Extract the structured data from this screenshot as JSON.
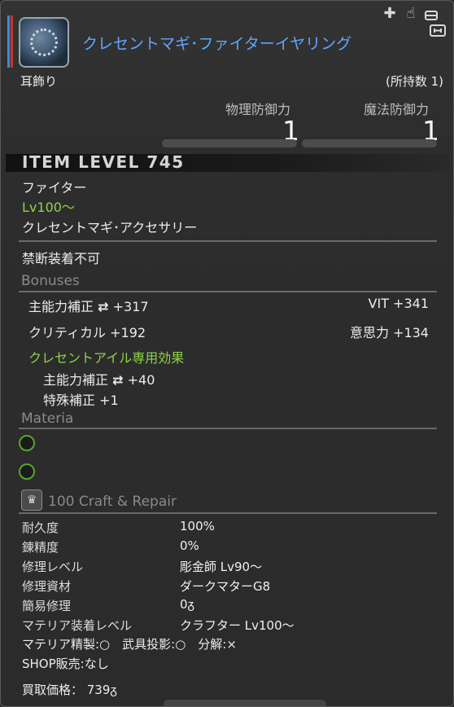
{
  "item": {
    "name": "クレセントマギ･ファイターイヤリング",
    "category": "耳飾り",
    "owned": "(所持数 1)"
  },
  "stats": [
    {
      "label": "物理防御力",
      "value": "1"
    },
    {
      "label": "魔法防御力",
      "value": "1"
    }
  ],
  "item_level": "ITEM LEVEL 745",
  "job": "ファイター",
  "level_req": "Lv100～",
  "item_type": "クレセントマギ･アクセサリー",
  "restriction": "禁断装着不可",
  "bonuses": {
    "title": "Bonuses",
    "rows": [
      {
        "left": "主能力補正",
        "left_icon": "arrow-mark",
        "left_value": "+317",
        "right": "VIT +341"
      },
      {
        "left": "クリティカル +192",
        "right": "意思力 +134"
      }
    ],
    "special_title": "クレセントアイル専用効果",
    "special_lines": [
      "主能力補正",
      "特殊補正 +1"
    ],
    "special_first_value": "+40"
  },
  "materia": {
    "title": "Materia",
    "slots": 2
  },
  "craft": {
    "title": "100 Craft & Repair",
    "icon": "crafting-crown-icon",
    "rows": [
      {
        "key": "耐久度",
        "value": "100%"
      },
      {
        "key": "錬精度",
        "value": "0%"
      },
      {
        "key": "修理レベル",
        "value": "彫金師 Lv90～"
      },
      {
        "key": "修理資材",
        "value": "ダークマターG8"
      },
      {
        "key": "簡易修理",
        "value": "0ᵹ"
      },
      {
        "key": "マテリア装着レベル",
        "value": "クラフター Lv100～"
      }
    ],
    "flags": "マテリア精製:○　武具投影:○　分解:×",
    "shop": "SHOP販売:なし",
    "sell_price": "買取価格：  739ᵹ"
  },
  "top_icons": [
    "plus-icon",
    "hand-icon",
    "chair-icon",
    "box-icon"
  ],
  "colors": {
    "name": "#5fa6ff",
    "green": "#8cd446"
  }
}
